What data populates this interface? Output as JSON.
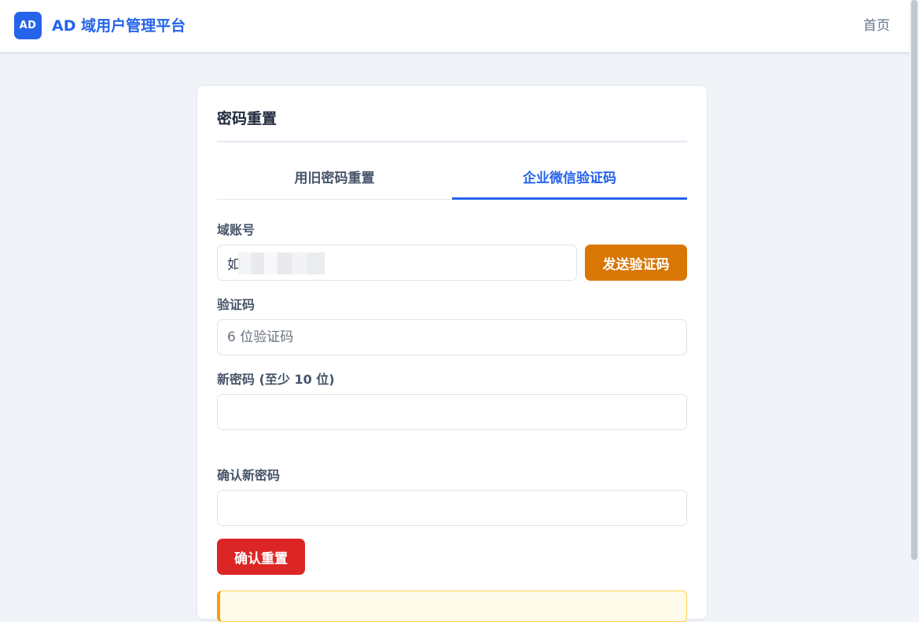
{
  "header": {
    "logo_text": "AD",
    "brand": "AD 域用户管理平台",
    "nav_home": "首页"
  },
  "card": {
    "title": "密码重置",
    "tabs": [
      {
        "label": "用旧密码重置",
        "active": false
      },
      {
        "label": "企业微信验证码",
        "active": true
      }
    ],
    "account": {
      "label": "域账号",
      "value": "如"
    },
    "send_code_label": "发送验证码",
    "code": {
      "label": "验证码",
      "placeholder": "6 位验证码"
    },
    "new_password": {
      "label": "新密码 (至少 10 位)",
      "placeholder": ""
    },
    "confirm_password": {
      "label": "确认新密码",
      "placeholder": ""
    },
    "confirm_label": "确认重置"
  },
  "colors": {
    "primary": "#2563eb",
    "send_button": "#d97706",
    "confirm_button": "#dc2626",
    "notice_border": "#f59e0b"
  }
}
